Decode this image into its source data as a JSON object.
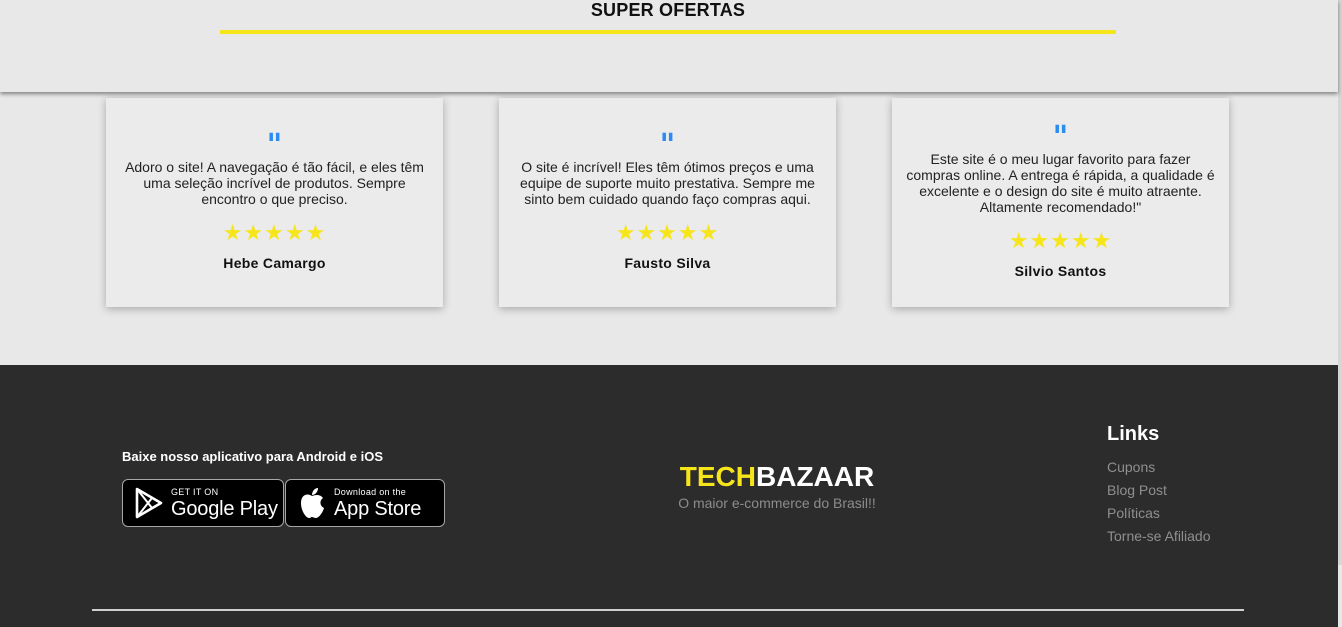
{
  "header": {
    "title": "SUPER OFERTAS"
  },
  "testimonials": [
    {
      "quote_mark": "\"",
      "text": "Adoro o site! A navegação é tão fácil, e eles têm uma seleção incrível de produtos. Sempre encontro o que preciso.",
      "stars": "★★★★★",
      "rating": 5,
      "author": "Hebe Camargo"
    },
    {
      "quote_mark": "\"",
      "text": "O site é incrível! Eles têm ótimos preços e uma equipe de suporte muito prestativa. Sempre me sinto bem cuidado quando faço compras aqui.",
      "stars": "★★★★★",
      "rating": 5,
      "author": "Fausto Silva"
    },
    {
      "quote_mark": "\"",
      "text": "Este site é o meu lugar favorito para fazer compras online. A entrega é rápida, a qualidade é excelente e o design do site é muito atraente. Altamente recomendado!\"",
      "stars": "★★★★★",
      "rating": 5,
      "author": "Silvio Santos"
    }
  ],
  "footer": {
    "app_heading": "Baixe nosso aplicativo para Android e iOS",
    "google_play": {
      "small": "GET IT ON",
      "big": "Google Play",
      "icon": "google-play-icon"
    },
    "app_store": {
      "small": "Download on the",
      "big": "App Store",
      "icon": "apple-icon"
    },
    "brand": {
      "tech": "TECH",
      "bazaar": "BAZAAR",
      "tagline": "O maior e-commerce do Brasil!!"
    },
    "links": {
      "title": "Links",
      "items": [
        "Cupons",
        "Blog Post",
        "Políticas",
        "Torne-se Afiliado"
      ]
    }
  },
  "colors": {
    "accent_yellow": "#f7e51c",
    "quote_blue": "#2a8cf0",
    "footer_bg": "#2c2c2c",
    "page_bg": "#e8e8e8"
  }
}
